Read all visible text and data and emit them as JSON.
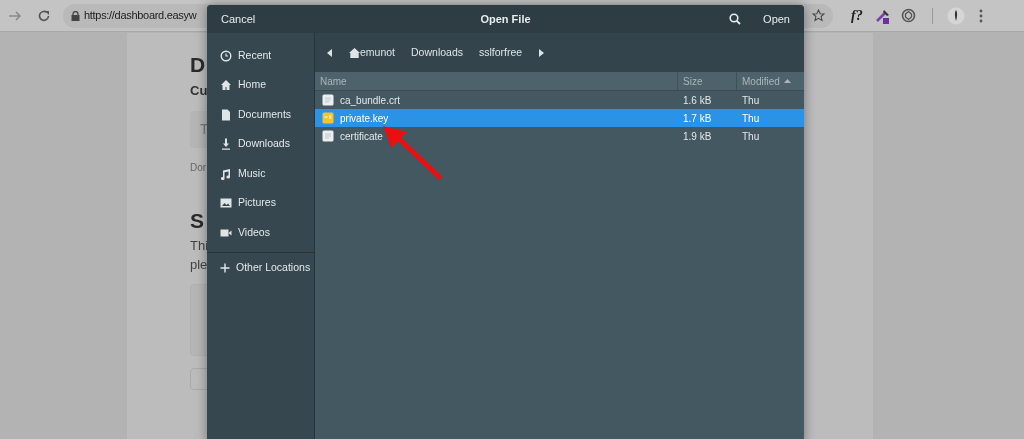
{
  "browser": {
    "url": "https://dashboard.easyw",
    "extension_text": "f?"
  },
  "page": {
    "heading": "D",
    "subheading": "Cu",
    "input_placeholder": "T",
    "hint": "Dor",
    "section_heading": "S",
    "paragraph_lines": [
      "Thi",
      "ple"
    ]
  },
  "dialog": {
    "title": "Open File",
    "cancel": "Cancel",
    "open": "Open",
    "sidebar": [
      {
        "label": "Recent",
        "kind": "recent"
      },
      {
        "label": "Home",
        "kind": "home"
      },
      {
        "label": "Documents",
        "kind": "documents"
      },
      {
        "label": "Downloads",
        "kind": "downloads"
      },
      {
        "label": "Music",
        "kind": "music"
      },
      {
        "label": "Pictures",
        "kind": "pictures"
      },
      {
        "label": "Videos",
        "kind": "videos"
      }
    ],
    "other_locations": "Other Locations",
    "path": [
      {
        "label": "emunot",
        "kind": "home"
      },
      {
        "label": "Downloads",
        "kind": "folder"
      },
      {
        "label": "sslforfree",
        "kind": "folder"
      }
    ],
    "columns": [
      "Name",
      "Size",
      "Modified"
    ],
    "files": [
      {
        "name": "ca_bundle.crt",
        "size": "1.6 kB",
        "modified": "Thu",
        "kind": "text",
        "selected": false
      },
      {
        "name": "private.key",
        "size": "1.7 kB",
        "modified": "Thu",
        "kind": "key",
        "selected": true
      },
      {
        "name": "certificate",
        "size": "1.9 kB",
        "modified": "Thu",
        "kind": "text",
        "selected": false
      }
    ]
  }
}
